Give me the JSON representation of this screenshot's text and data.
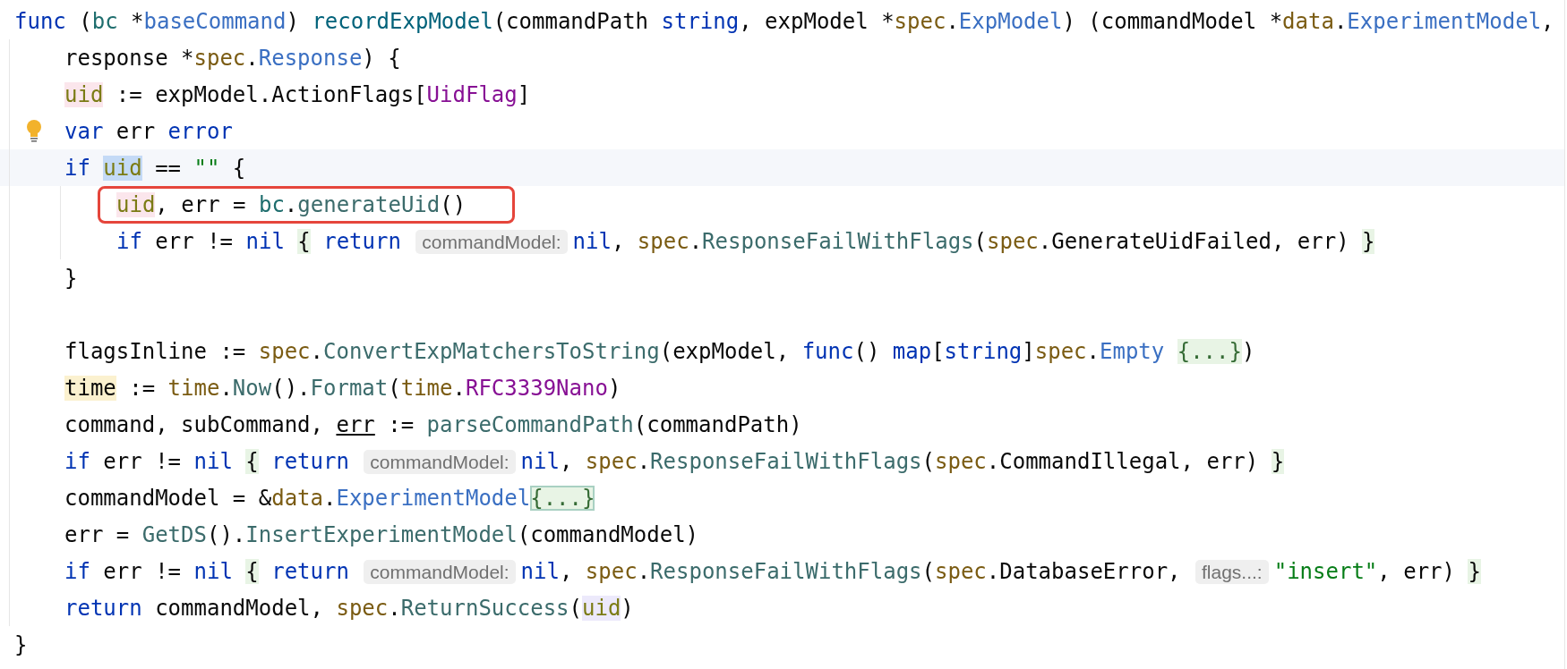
{
  "lines": [
    {
      "tokens": [
        {
          "t": "func ",
          "kind": "kw"
        },
        {
          "t": "(",
          "kind": "p"
        },
        {
          "t": "bc",
          "kind": "recv"
        },
        {
          "t": " *",
          "kind": "p"
        },
        {
          "t": "baseCommand",
          "kind": "type"
        },
        {
          "t": ") ",
          "kind": "p"
        },
        {
          "t": "recordExpModel",
          "kind": "fn"
        },
        {
          "t": "(commandPath ",
          "kind": "p"
        },
        {
          "t": "string",
          "kind": "kw"
        },
        {
          "t": ", expModel *",
          "kind": "p"
        },
        {
          "t": "spec",
          "kind": "pkg"
        },
        {
          "t": ".",
          "kind": "p"
        },
        {
          "t": "ExpModel",
          "kind": "type"
        },
        {
          "t": ") (commandModel *",
          "kind": "p"
        },
        {
          "t": "data",
          "kind": "pkg"
        },
        {
          "t": ".",
          "kind": "p"
        },
        {
          "t": "ExperimentModel",
          "kind": "type"
        },
        {
          "t": ",",
          "kind": "p"
        }
      ],
      "children": [
        {
          "tokens": [
            {
              "t": "response *",
              "kind": "p"
            },
            {
              "t": "spec",
              "kind": "pkg"
            },
            {
              "t": ".",
              "kind": "p"
            },
            {
              "t": "Response",
              "kind": "type"
            },
            {
              "t": ") {",
              "kind": "p"
            }
          ]
        },
        {
          "tokens": [
            {
              "t": "uid",
              "kind": "var",
              "written": true
            },
            {
              "t": " := expModel.ActionFlags[",
              "kind": "p"
            },
            {
              "t": "UidFlag",
              "kind": "const"
            },
            {
              "t": "]",
              "kind": "p"
            }
          ]
        },
        {
          "bulb": true,
          "tokens": [
            {
              "t": "var ",
              "kind": "kw"
            },
            {
              "t": "err ",
              "kind": "p"
            },
            {
              "t": "error",
              "kind": "kw"
            }
          ]
        },
        {
          "current": true,
          "tokens": [
            {
              "t": "if ",
              "kind": "kw"
            },
            {
              "t": "uid",
              "kind": "var",
              "selected": true
            },
            {
              "t": " == ",
              "kind": "p"
            },
            {
              "t": "\"\"",
              "kind": "str"
            },
            {
              "t": " {",
              "kind": "p"
            }
          ],
          "children": [
            {
              "boxed": true,
              "tokens": [
                {
                  "t": "uid",
                  "kind": "var",
                  "written": true
                },
                {
                  "t": ", err = ",
                  "kind": "p"
                },
                {
                  "t": "bc",
                  "kind": "recv"
                },
                {
                  "t": ".",
                  "kind": "p"
                },
                {
                  "t": "generateUid",
                  "kind": "call"
                },
                {
                  "t": "()",
                  "kind": "p"
                }
              ]
            },
            {
              "tokens": [
                {
                  "t": "if ",
                  "kind": "kw"
                },
                {
                  "t": "err != ",
                  "kind": "p"
                },
                {
                  "t": "nil ",
                  "kind": "kw"
                },
                {
                  "t": "{",
                  "kind": "p",
                  "matched": true
                },
                {
                  "t": " return ",
                  "kind": "kw"
                },
                {
                  "t": "commandModel:",
                  "kind": "hint"
                },
                {
                  "t": "nil",
                  "kind": "kw"
                },
                {
                  "t": ", ",
                  "kind": "p"
                },
                {
                  "t": "spec",
                  "kind": "pkg"
                },
                {
                  "t": ".",
                  "kind": "p"
                },
                {
                  "t": "ResponseFailWithFlags",
                  "kind": "call"
                },
                {
                  "t": "(",
                  "kind": "p"
                },
                {
                  "t": "spec",
                  "kind": "pkg"
                },
                {
                  "t": ".GenerateUidFailed, err) ",
                  "kind": "p"
                },
                {
                  "t": "}",
                  "kind": "p",
                  "matched": true
                }
              ]
            }
          ]
        },
        {
          "tokens": [
            {
              "t": "}",
              "kind": "p"
            }
          ]
        },
        {
          "kind": "blank"
        },
        {
          "tokens": [
            {
              "t": "flagsInline := ",
              "kind": "p"
            },
            {
              "t": "spec",
              "kind": "pkg"
            },
            {
              "t": ".",
              "kind": "p"
            },
            {
              "t": "ConvertExpMatchersToString",
              "kind": "call"
            },
            {
              "t": "(expModel, ",
              "kind": "p"
            },
            {
              "t": "func",
              "kind": "kw"
            },
            {
              "t": "() ",
              "kind": "p"
            },
            {
              "t": "map",
              "kind": "kw"
            },
            {
              "t": "[",
              "kind": "p"
            },
            {
              "t": "string",
              "kind": "kw"
            },
            {
              "t": "]",
              "kind": "p"
            },
            {
              "t": "spec",
              "kind": "pkg"
            },
            {
              "t": ".",
              "kind": "p"
            },
            {
              "t": "Empty ",
              "kind": "type"
            },
            {
              "t": "{...}",
              "kind": "fold",
              "matched": true
            },
            {
              "t": ")",
              "kind": "p"
            }
          ]
        },
        {
          "tokens": [
            {
              "t": "time",
              "kind": "p",
              "declared": true
            },
            {
              "t": " := ",
              "kind": "p"
            },
            {
              "t": "time",
              "kind": "pkg"
            },
            {
              "t": ".",
              "kind": "p"
            },
            {
              "t": "Now",
              "kind": "call"
            },
            {
              "t": "().",
              "kind": "p"
            },
            {
              "t": "Format",
              "kind": "call"
            },
            {
              "t": "(",
              "kind": "p"
            },
            {
              "t": "time",
              "kind": "pkg"
            },
            {
              "t": ".",
              "kind": "p"
            },
            {
              "t": "RFC3339Nano",
              "kind": "const"
            },
            {
              "t": ")",
              "kind": "p"
            }
          ]
        },
        {
          "tokens": [
            {
              "t": "command, subCommand, ",
              "kind": "p"
            },
            {
              "t": "err",
              "kind": "p",
              "underline": true
            },
            {
              "t": " := ",
              "kind": "p"
            },
            {
              "t": "parseCommandPath",
              "kind": "call"
            },
            {
              "t": "(commandPath)",
              "kind": "p"
            }
          ]
        },
        {
          "tokens": [
            {
              "t": "if ",
              "kind": "kw"
            },
            {
              "t": "err != ",
              "kind": "p"
            },
            {
              "t": "nil ",
              "kind": "kw"
            },
            {
              "t": "{",
              "kind": "p",
              "matched": true
            },
            {
              "t": " return ",
              "kind": "kw"
            },
            {
              "t": "commandModel:",
              "kind": "hint"
            },
            {
              "t": "nil",
              "kind": "kw"
            },
            {
              "t": ", ",
              "kind": "p"
            },
            {
              "t": "spec",
              "kind": "pkg"
            },
            {
              "t": ".",
              "kind": "p"
            },
            {
              "t": "ResponseFailWithFlags",
              "kind": "call"
            },
            {
              "t": "(",
              "kind": "p"
            },
            {
              "t": "spec",
              "kind": "pkg"
            },
            {
              "t": ".CommandIllegal, err) ",
              "kind": "p"
            },
            {
              "t": "}",
              "kind": "p",
              "matched": true
            }
          ]
        },
        {
          "tokens": [
            {
              "t": "commandModel = &",
              "kind": "p"
            },
            {
              "t": "data",
              "kind": "pkg"
            },
            {
              "t": ".",
              "kind": "p"
            },
            {
              "t": "ExperimentModel",
              "kind": "type"
            },
            {
              "t": "{...}",
              "kind": "fold",
              "matched": true,
              "focused": true
            }
          ]
        },
        {
          "tokens": [
            {
              "t": "err = ",
              "kind": "p"
            },
            {
              "t": "GetDS",
              "kind": "call"
            },
            {
              "t": "().",
              "kind": "p"
            },
            {
              "t": "InsertExperimentModel",
              "kind": "call"
            },
            {
              "t": "(commandModel)",
              "kind": "p"
            }
          ]
        },
        {
          "tokens": [
            {
              "t": "if ",
              "kind": "kw"
            },
            {
              "t": "err != ",
              "kind": "p"
            },
            {
              "t": "nil ",
              "kind": "kw"
            },
            {
              "t": "{",
              "kind": "p",
              "matched": true
            },
            {
              "t": " return ",
              "kind": "kw"
            },
            {
              "t": "commandModel:",
              "kind": "hint"
            },
            {
              "t": "nil",
              "kind": "kw"
            },
            {
              "t": ", ",
              "kind": "p"
            },
            {
              "t": "spec",
              "kind": "pkg"
            },
            {
              "t": ".",
              "kind": "p"
            },
            {
              "t": "ResponseFailWithFlags",
              "kind": "call"
            },
            {
              "t": "(",
              "kind": "p"
            },
            {
              "t": "spec",
              "kind": "pkg"
            },
            {
              "t": ".DatabaseError, ",
              "kind": "p"
            },
            {
              "t": "flags...:",
              "kind": "hint"
            },
            {
              "t": "\"insert\"",
              "kind": "str"
            },
            {
              "t": ", err) ",
              "kind": "p"
            },
            {
              "t": "}",
              "kind": "p",
              "matched": true
            }
          ]
        },
        {
          "tokens": [
            {
              "t": "return ",
              "kind": "kw"
            },
            {
              "t": "commandModel, ",
              "kind": "p"
            },
            {
              "t": "spec",
              "kind": "pkg"
            },
            {
              "t": ".",
              "kind": "p"
            },
            {
              "t": "ReturnSuccess",
              "kind": "call"
            },
            {
              "t": "(",
              "kind": "p"
            },
            {
              "t": "uid",
              "kind": "var",
              "usage": true
            },
            {
              "t": ")",
              "kind": "p"
            }
          ]
        }
      ]
    },
    {
      "tokens": [
        {
          "t": "}",
          "kind": "p"
        }
      ]
    }
  ]
}
